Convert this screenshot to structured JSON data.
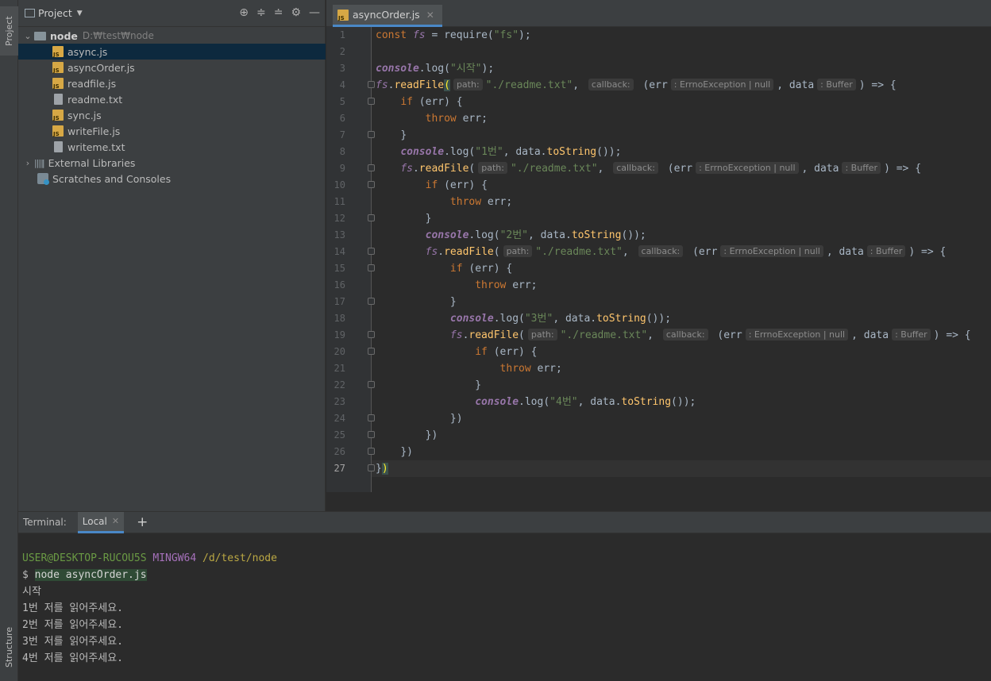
{
  "toolwindows": {
    "project_tab": "Project",
    "structure_tab": "Structure"
  },
  "project_panel": {
    "title": "Project",
    "root": {
      "name": "node",
      "path": "D:₩test₩node"
    },
    "files": [
      {
        "name": "async.js",
        "type": "js"
      },
      {
        "name": "asyncOrder.js",
        "type": "js"
      },
      {
        "name": "readfile.js",
        "type": "js"
      },
      {
        "name": "readme.txt",
        "type": "txt"
      },
      {
        "name": "sync.js",
        "type": "js"
      },
      {
        "name": "writeFile.js",
        "type": "js"
      },
      {
        "name": "writeme.txt",
        "type": "txt"
      }
    ],
    "external_libraries": "External Libraries",
    "scratches": "Scratches and Consoles"
  },
  "editor": {
    "active_tab": "asyncOrder.js",
    "current_line": 27,
    "line_numbers": [
      "1",
      "2",
      "3",
      "4",
      "5",
      "6",
      "7",
      "8",
      "9",
      "10",
      "11",
      "12",
      "13",
      "14",
      "15",
      "16",
      "17",
      "18",
      "19",
      "20",
      "21",
      "22",
      "23",
      "24",
      "25",
      "26",
      "27"
    ],
    "code": {
      "l1_const": "const",
      "l1_fs": "fs",
      "l1_eq": " = require(",
      "l1_str": "\"fs\"",
      "l1_end": ");",
      "l3_console": "console",
      "l3_log": ".log(",
      "l3_str": "\"시작\"",
      "l3_end": ");",
      "hint_path": "path:",
      "hint_callback": "callback:",
      "hint_err": ": ErrnoException | null",
      "hint_data": ": Buffer",
      "readfile_call": "readFile",
      "readme": "\"./readme.txt\"",
      "cb_open": " (err",
      "cb_mid": ", data",
      "cb_close": ") => {",
      "if_kw": "if",
      "if_rest": " (err) {",
      "throw_kw": "throw",
      "throw_rest": " err;",
      "close_brace": "}",
      "close_paren": "})",
      "tostring_call": "toString",
      "tostring_end": "());",
      "log1": "\"1번\"",
      "log2": "\"2번\"",
      "log3": "\"3번\"",
      "log4": "\"4번\"",
      "data_ref": " data.",
      "comma": ",",
      "fs": "fs",
      "dot": ".",
      "paren": "("
    }
  },
  "terminal": {
    "label": "Terminal:",
    "tab": "Local",
    "prompt_user": "USER@DESKTOP-RUCOU5S",
    "prompt_env": "MINGW64",
    "prompt_path": "/d/test/node",
    "prompt_symbol": "$",
    "command": "node asyncOrder.js",
    "output": [
      "시작",
      "1번 저를 읽어주세요.",
      "2번 저를 읽어주세요.",
      "3번 저를 읽어주세요.",
      "4번 저를 읽어주세요."
    ]
  },
  "colors": {
    "accent": "#4a88c7",
    "keyword": "#cc7832",
    "string": "#6a8759",
    "function": "#ffc66d",
    "global": "#9876aa"
  }
}
